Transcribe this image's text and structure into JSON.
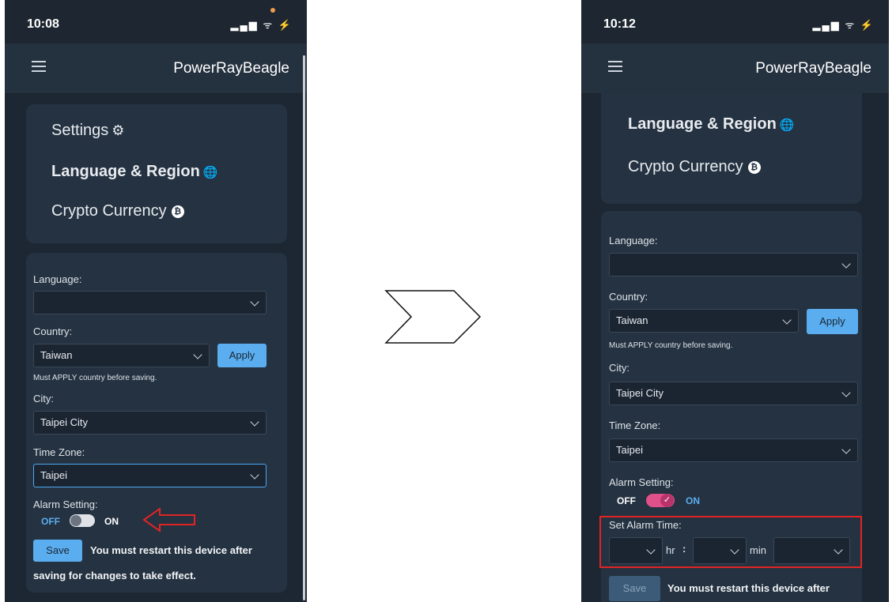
{
  "left": {
    "status": {
      "time": "10:08",
      "icons": "▂▄▆ ᯤ ⚡"
    },
    "app_title": "PowerRayBeagle",
    "nav": {
      "settings": "Settings",
      "settings_icon": "⚙",
      "language": "Language & Region",
      "language_icon": "🌐",
      "crypto": "Crypto Currency",
      "crypto_icon": "₿"
    },
    "form": {
      "language_label": "Language:",
      "language_value": "",
      "country_label": "Country:",
      "country_value": "Taiwan",
      "apply": "Apply",
      "apply_note": "Must APPLY country before saving.",
      "city_label": "City:",
      "city_value": "Taipei City",
      "tz_label": "Time Zone:",
      "tz_value": "Taipei",
      "alarm_label": "Alarm Setting:",
      "off": "OFF",
      "on": "ON",
      "save": "Save",
      "warn_1": "You must restart this device after",
      "warn_2": "saving for changes to take effect."
    }
  },
  "right": {
    "status": {
      "time": "10:12",
      "icons": "▂▄▆ ᯤ ⚡"
    },
    "app_title": "PowerRayBeagle",
    "nav": {
      "language": "Language & Region",
      "language_icon": "🌐",
      "crypto": "Crypto Currency",
      "crypto_icon": "₿"
    },
    "form": {
      "language_label": "Language:",
      "language_value": "",
      "country_label": "Country:",
      "country_value": "Taiwan",
      "apply": "Apply",
      "apply_note": "Must APPLY country before saving.",
      "city_label": "City:",
      "city_value": "Taipei City",
      "tz_label": "Time Zone:",
      "tz_value": "Taipei",
      "alarm_label": "Alarm Setting:",
      "off": "OFF",
      "on": "ON",
      "set_alarm_label": "Set Alarm Time:",
      "hr": "hr",
      "colon": ":",
      "min": "min",
      "save": "Save",
      "warn_1": "You must restart this device after"
    }
  },
  "colors": {
    "accent": "#5aaef0",
    "toggle_on": "#e0508a",
    "highlight": "#e02424",
    "bg": "#1d2733"
  }
}
